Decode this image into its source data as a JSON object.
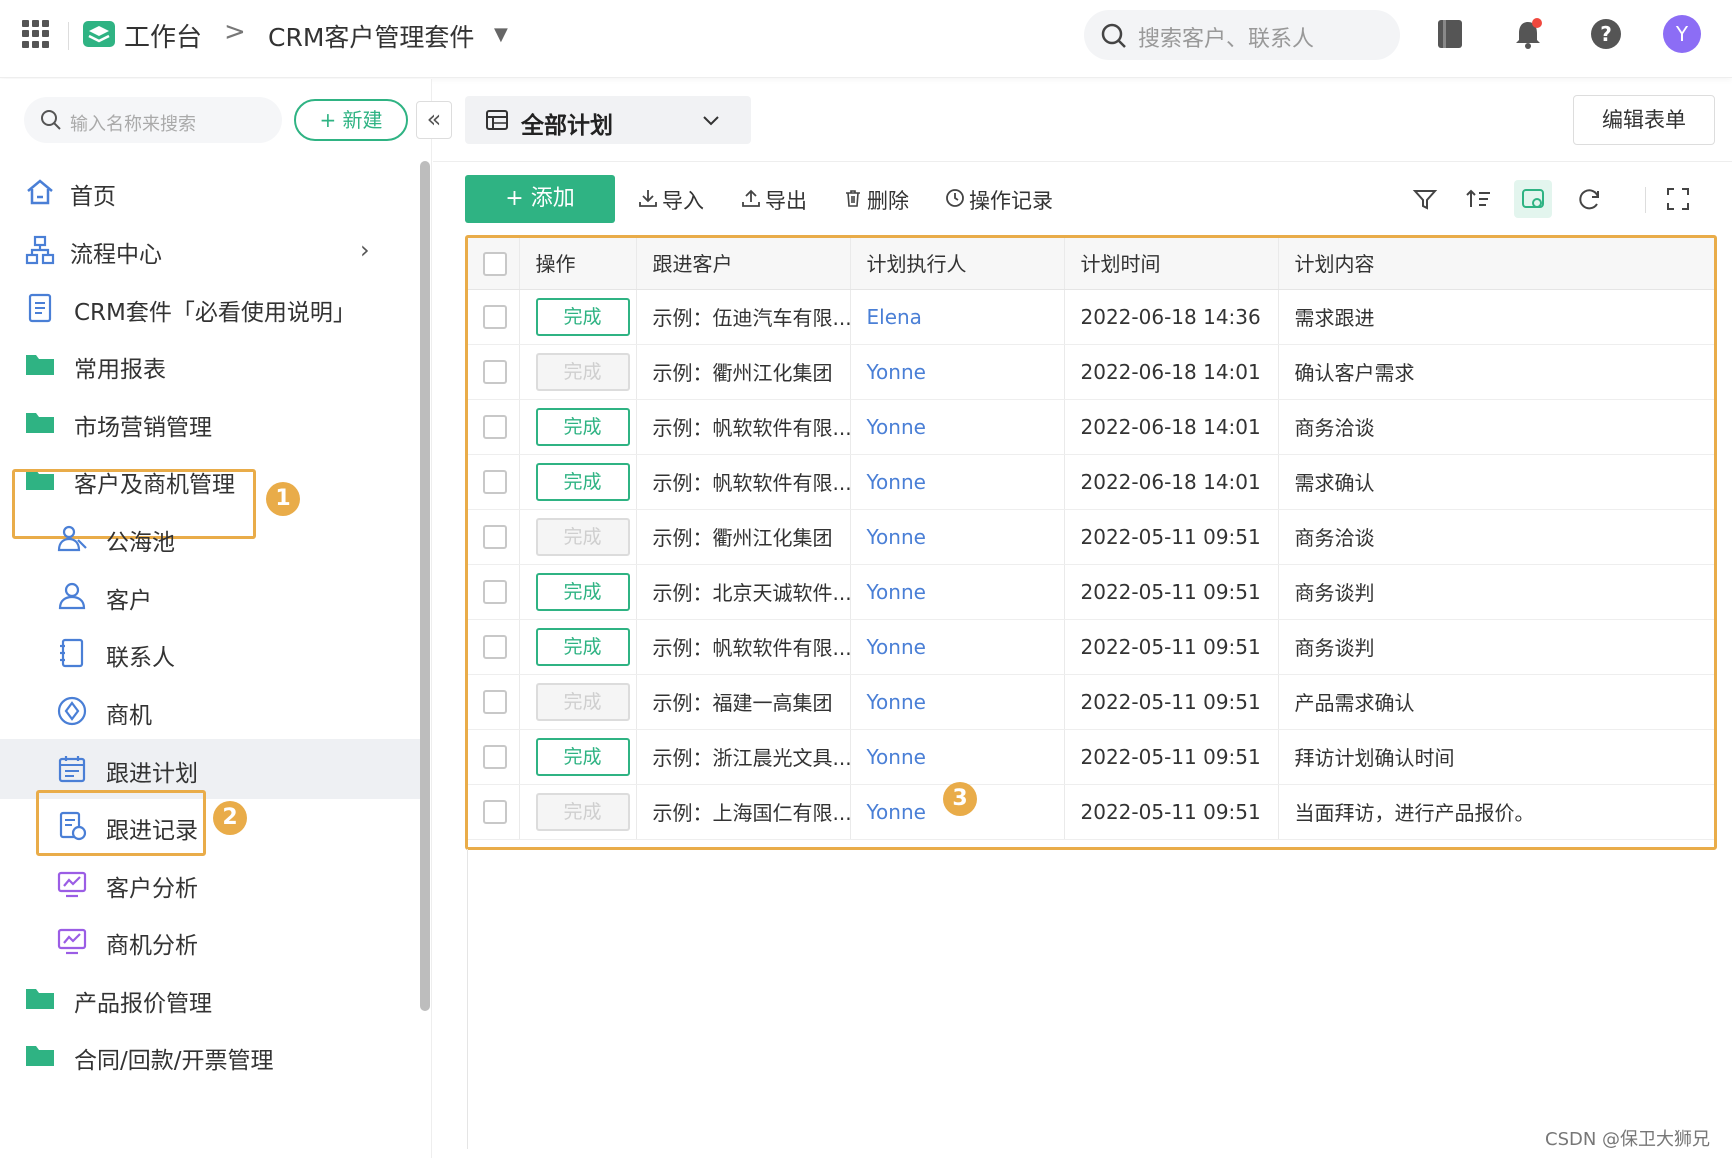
{
  "topbar": {
    "workspace": "工作台",
    "breadcrumb_sep": ">",
    "app_name": "CRM客户管理套件",
    "search_placeholder": "搜索客户、联系人",
    "avatar_initial": "Y"
  },
  "sidebar": {
    "search_placeholder": "输入名称来搜索",
    "new_label": "+ 新建",
    "collapse_label": "«",
    "items": [
      {
        "label": "首页",
        "icon": "home-icon"
      },
      {
        "label": "流程中心",
        "icon": "flow-icon"
      },
      {
        "label": "CRM套件「必看使用说明」",
        "icon": "doc-icon"
      },
      {
        "label": "常用报表",
        "icon": "folder-icon"
      },
      {
        "label": "市场营销管理",
        "icon": "folder-icon"
      },
      {
        "label": "客户及商机管理",
        "icon": "folder-icon"
      },
      {
        "label": "公海池",
        "icon": "users-icon"
      },
      {
        "label": "客户",
        "icon": "user-icon"
      },
      {
        "label": "联系人",
        "icon": "contact-icon"
      },
      {
        "label": "商机",
        "icon": "opportunity-icon"
      },
      {
        "label": "跟进计划",
        "icon": "calendar-icon"
      },
      {
        "label": "跟进记录",
        "icon": "record-icon"
      },
      {
        "label": "客户分析",
        "icon": "chart-icon"
      },
      {
        "label": "商机分析",
        "icon": "chart-icon"
      },
      {
        "label": "产品报价管理",
        "icon": "folder-icon"
      },
      {
        "label": "合同/回款/开票管理",
        "icon": "folder-icon"
      }
    ]
  },
  "annotations": [
    "1",
    "2",
    "3"
  ],
  "main": {
    "view_label": "全部计划",
    "edit_form_label": "编辑表单",
    "add_label": "+ 添加",
    "tools": {
      "import": "导入",
      "export": "导出",
      "delete": "删除",
      "oplog": "操作记录"
    }
  },
  "table": {
    "columns": [
      "操作",
      "跟进客户",
      "计划执行人",
      "计划时间",
      "计划内容"
    ],
    "done_label": "完成",
    "rows": [
      {
        "active": true,
        "customer": "示例：伍迪汽车有限...",
        "executor": "Elena",
        "time": "2022-06-18 14:36",
        "content": "需求跟进"
      },
      {
        "active": false,
        "customer": "示例：衢州江化集团",
        "executor": "Yonne",
        "time": "2022-06-18 14:01",
        "content": "确认客户需求"
      },
      {
        "active": true,
        "customer": "示例：帆软软件有限...",
        "executor": "Yonne",
        "time": "2022-06-18 14:01",
        "content": "商务洽谈"
      },
      {
        "active": true,
        "customer": "示例：帆软软件有限...",
        "executor": "Yonne",
        "time": "2022-06-18 14:01",
        "content": "需求确认"
      },
      {
        "active": false,
        "customer": "示例：衢州江化集团",
        "executor": "Yonne",
        "time": "2022-05-11 09:51",
        "content": "商务洽谈"
      },
      {
        "active": true,
        "customer": "示例：北京天诚软件...",
        "executor": "Yonne",
        "time": "2022-05-11 09:51",
        "content": "商务谈判"
      },
      {
        "active": true,
        "customer": "示例：帆软软件有限...",
        "executor": "Yonne",
        "time": "2022-05-11 09:51",
        "content": "商务谈判"
      },
      {
        "active": false,
        "customer": "示例：福建一高集团",
        "executor": "Yonne",
        "time": "2022-05-11 09:51",
        "content": "产品需求确认"
      },
      {
        "active": true,
        "customer": "示例：浙江晨光文具...",
        "executor": "Yonne",
        "time": "2022-05-11 09:51",
        "content": "拜访计划确认时间"
      },
      {
        "active": false,
        "customer": "示例：上海国仁有限...",
        "executor": "Yonne",
        "time": "2022-05-11 09:51",
        "content": "当面拜访，进行产品报价。"
      }
    ]
  },
  "watermark": "CSDN @保卫大狮兄",
  "colors": {
    "accent": "#2fb383",
    "highlight": "#e9ac49",
    "link": "#4a7fd6"
  }
}
